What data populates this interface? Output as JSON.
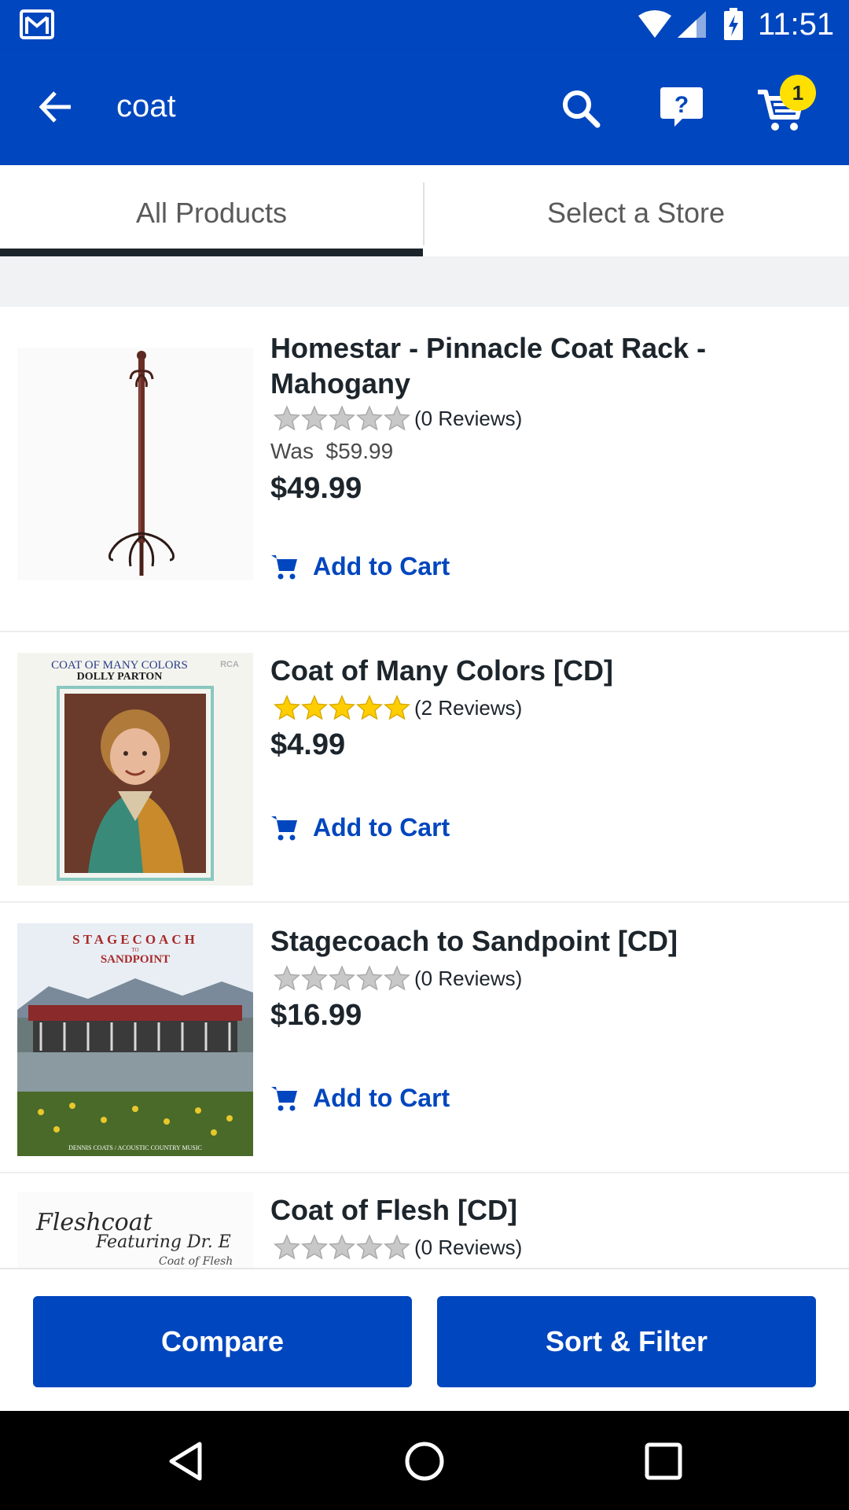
{
  "status_bar": {
    "time": "11:51",
    "icons": [
      "gmail-icon",
      "wifi-icon",
      "signal-icon",
      "battery-charging-icon"
    ]
  },
  "header": {
    "query": "coat",
    "cart_count": "1",
    "icons": [
      "back-arrow-icon",
      "search-icon",
      "help-icon",
      "cart-icon"
    ]
  },
  "tabs": [
    {
      "label": "All Products",
      "selected": true
    },
    {
      "label": "Select a Store",
      "selected": false
    }
  ],
  "products": [
    {
      "name": "Homestar - Pinnacle Coat Rack - Mahogany",
      "rating": 0,
      "reviews": "(0 Reviews)",
      "was_label": "Was",
      "was_price": "$59.99",
      "price": "$49.99",
      "action": "Add to Cart"
    },
    {
      "name": "Coat of Many Colors [CD]",
      "rating": 5,
      "reviews": "(2 Reviews)",
      "price": "$4.99",
      "action": "Add to Cart",
      "art_text": {
        "title": "COAT OF MANY COLORS",
        "artist": "DOLLY PARTON",
        "label": "RCA"
      }
    },
    {
      "name": "Stagecoach to Sandpoint [CD]",
      "rating": 0,
      "reviews": "(0 Reviews)",
      "price": "$16.99",
      "action": "Add to Cart",
      "art_text": {
        "title": "STAGECOACH",
        "to": "TO",
        "subtitle": "SANDPOINT",
        "footer": "DENNIS COATS / ACOUSTIC COUNTRY MUSIC"
      }
    },
    {
      "name": "Coat of Flesh [CD]",
      "rating": 0,
      "reviews": "(0 Reviews)",
      "art_text": {
        "line1": "Fleshcoat",
        "line2": "Featuring Dr. E",
        "line3": "Coat of Flesh"
      }
    }
  ],
  "bottom_bar": {
    "compare": "Compare",
    "sort_filter": "Sort & Filter"
  },
  "colors": {
    "brand_blue": "#0046be",
    "badge_yellow": "#ffe000",
    "star_gold": "#ffce00",
    "star_empty": "#b9b9b9"
  },
  "nav_icons": [
    "nav-back-icon",
    "nav-home-icon",
    "nav-recents-icon"
  ]
}
